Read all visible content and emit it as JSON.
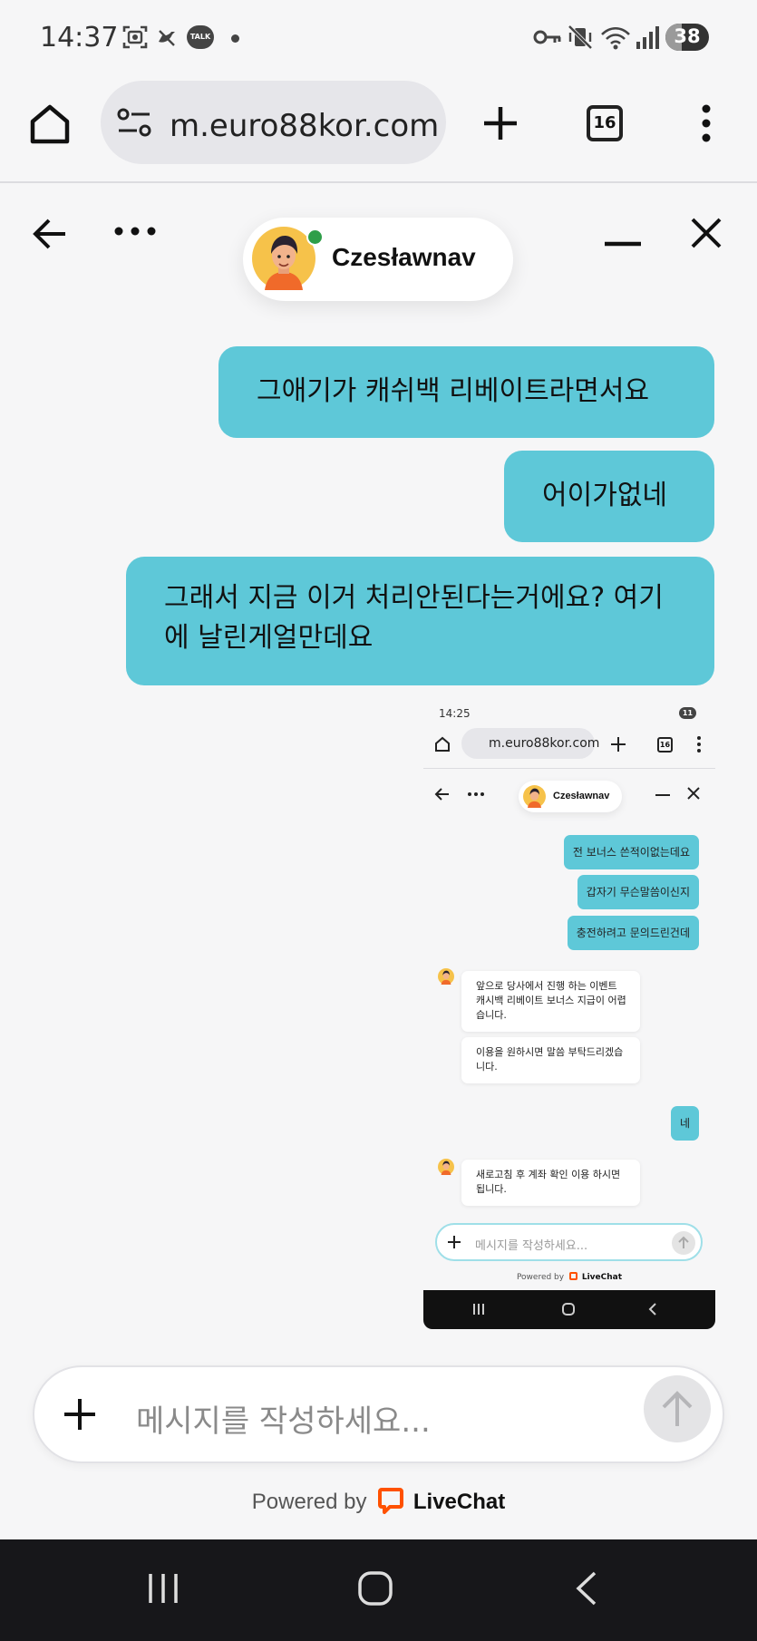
{
  "status_bar": {
    "time": "14:37",
    "notification_icons": [
      "screenshot-icon",
      "dnd-bird-icon",
      "kakaotalk-icon",
      "dot-icon"
    ],
    "talk_badge": "TALK",
    "system_icons": [
      "key-icon",
      "vibrate-icon",
      "wifi-icon",
      "signal-icon"
    ],
    "battery": "38"
  },
  "browser": {
    "url": "m.euro88kor.com",
    "tab_count": "16"
  },
  "chat": {
    "agent_name": "Czesławnav",
    "messages": [
      {
        "from": "visitor",
        "text": "그애기가 캐쉬백 리베이트라면서요"
      },
      {
        "from": "visitor",
        "text": "어이가없네"
      },
      {
        "from": "visitor",
        "text": "그래서 지금 이거 처리안된다는거에요? 여기에 날린게얼만데요"
      }
    ],
    "attachment": {
      "time": "14:25",
      "url": "m.euro88kor.com",
      "tab_count": "16",
      "battery": "11",
      "agent_name": "Czesławnav",
      "messages": [
        {
          "from": "visitor",
          "text": "전 보너스 쓴적이없는데요"
        },
        {
          "from": "visitor",
          "text": "갑자기 무슨말씀이신지"
        },
        {
          "from": "visitor",
          "text": "충전하려고 문의드린건데"
        },
        {
          "from": "agent",
          "text": "앞으로 당사에서 진행 하는 이벤트 캐시백 리베이트 보너스 지급이 어렵습니다."
        },
        {
          "from": "agent",
          "text": "이용을 원하시면 말씀 부탁드리겠습니다."
        },
        {
          "from": "visitor",
          "text": "네"
        },
        {
          "from": "agent",
          "text": "새로고침 후 계좌 확인 이용 하시면 됩니다."
        }
      ],
      "placeholder": "메시지를 작성하세요...",
      "powered_by": "Powered by",
      "brand": "LiveChat"
    }
  },
  "composer": {
    "placeholder": "메시지를 작성하세요..."
  },
  "footer": {
    "powered_by": "Powered by",
    "brand": "LiveChat"
  },
  "colors": {
    "visitor_bubble": "#5ec8d8",
    "background": "#f6f6f7",
    "online_dot": "#2e9e48",
    "livechat_orange": "#ff5100"
  }
}
